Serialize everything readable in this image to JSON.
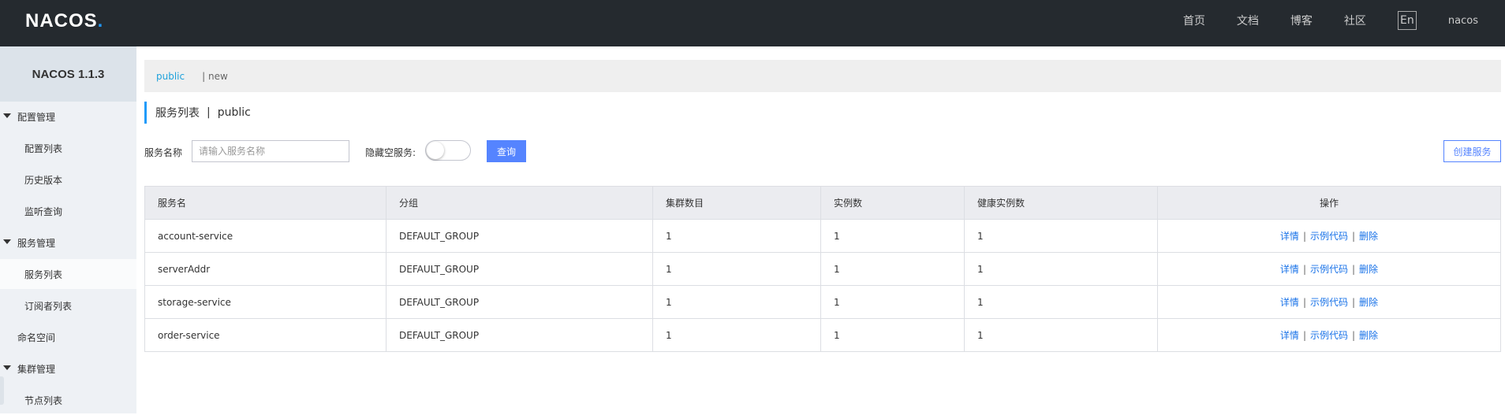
{
  "header": {
    "logo": "NACOS",
    "logo_dot": ".",
    "nav": [
      "首页",
      "文档",
      "博客",
      "社区"
    ],
    "lang": "En",
    "user": "nacos"
  },
  "sidebar": {
    "version": "NACOS 1.1.3",
    "groups": [
      {
        "label": "配置管理",
        "children": [
          "配置列表",
          "历史版本",
          "监听查询"
        ]
      },
      {
        "label": "服务管理",
        "children": [
          "服务列表",
          "订阅者列表"
        ]
      },
      {
        "label": "命名空间"
      },
      {
        "label": "集群管理",
        "children": [
          "节点列表"
        ]
      }
    ],
    "active_item": "服务列表"
  },
  "namespace_bar": {
    "current": "public",
    "separator": "|",
    "other": "new"
  },
  "page_title": {
    "main": "服务列表",
    "divider": "|",
    "namespace": "public"
  },
  "filter": {
    "service_name_label": "服务名称",
    "service_name_placeholder": "请输入服务名称",
    "hide_empty_label": "隐藏空服务:",
    "hide_empty_on": false,
    "query_button": "查询",
    "create_button": "创建服务"
  },
  "table": {
    "columns": [
      "服务名",
      "分组",
      "集群数目",
      "实例数",
      "健康实例数",
      "操作"
    ],
    "rows": [
      {
        "name": "account-service",
        "group": "DEFAULT_GROUP",
        "clusters": "1",
        "instances": "1",
        "healthy": "1"
      },
      {
        "name": "serverAddr",
        "group": "DEFAULT_GROUP",
        "clusters": "1",
        "instances": "1",
        "healthy": "1"
      },
      {
        "name": "storage-service",
        "group": "DEFAULT_GROUP",
        "clusters": "1",
        "instances": "1",
        "healthy": "1"
      },
      {
        "name": "order-service",
        "group": "DEFAULT_GROUP",
        "clusters": "1",
        "instances": "1",
        "healthy": "1"
      }
    ],
    "actions": {
      "detail": "详情",
      "sample_code": "示例代码",
      "delete": "删除",
      "sep": "|"
    }
  },
  "colors": {
    "header_bg": "#252a2f",
    "sidebar_bg": "#eef1f5",
    "accent": "#5584ff",
    "link": "#1a73e8",
    "ns_active": "#1fa2dc"
  }
}
